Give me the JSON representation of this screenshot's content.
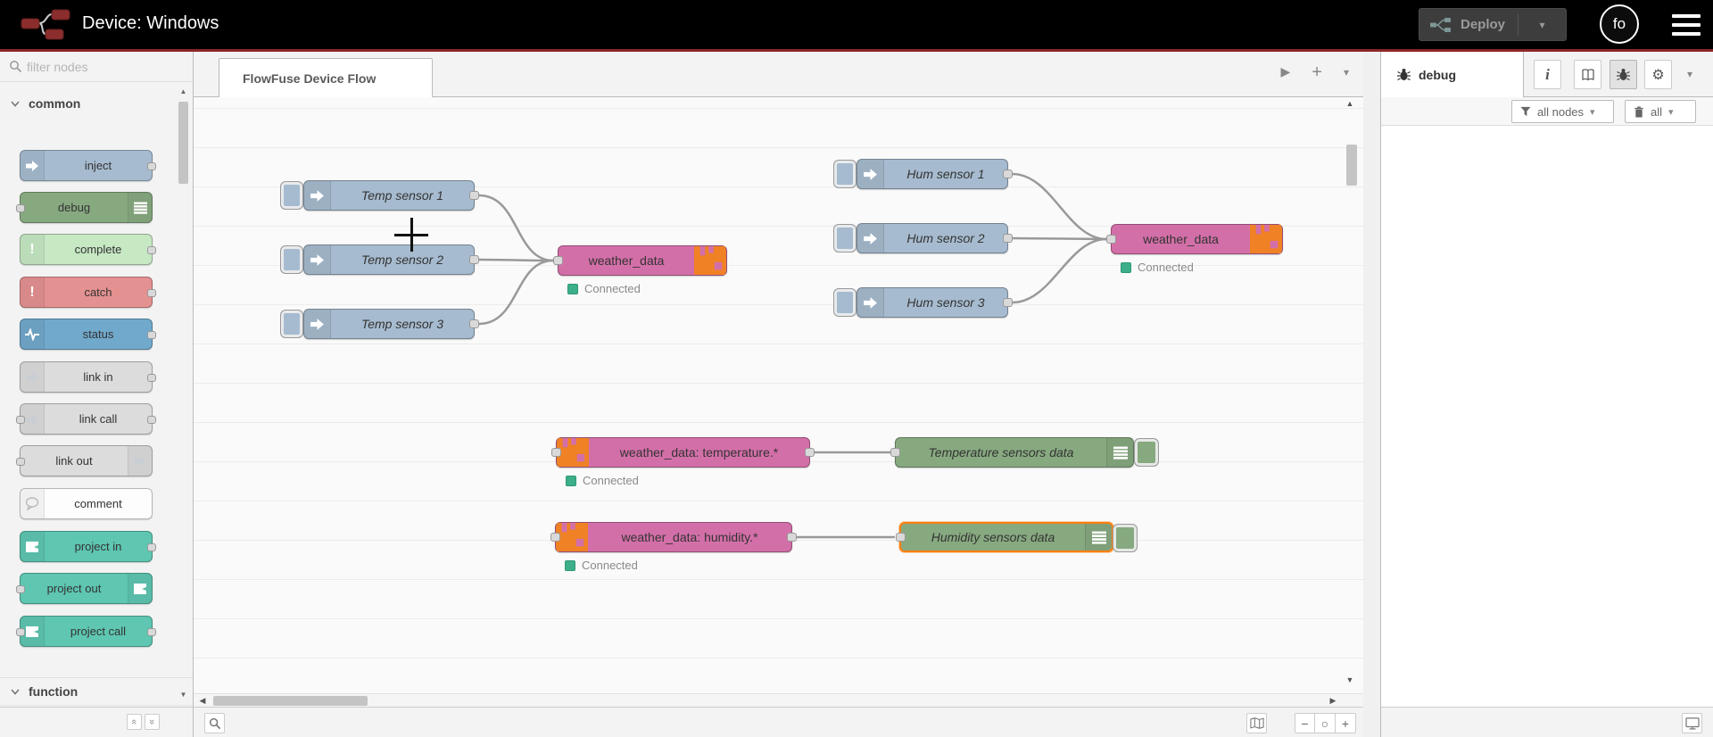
{
  "header": {
    "title": "Device: Windows",
    "deploy_label": "Deploy",
    "avatar_initials": "fo"
  },
  "palette": {
    "filter_placeholder": "filter nodes",
    "categories": [
      {
        "label": "common",
        "items": [
          {
            "label": "inject"
          },
          {
            "label": "debug"
          },
          {
            "label": "complete"
          },
          {
            "label": "catch"
          },
          {
            "label": "status"
          },
          {
            "label": "link in"
          },
          {
            "label": "link call"
          },
          {
            "label": "link out"
          },
          {
            "label": "comment"
          },
          {
            "label": "project in"
          },
          {
            "label": "project out"
          },
          {
            "label": "project call"
          }
        ]
      },
      {
        "label": "function",
        "items": []
      }
    ]
  },
  "tabbar": {
    "active_tab": "FlowFuse Device Flow"
  },
  "canvas": {
    "connected_label": "Connected",
    "nodes": {
      "temp1": {
        "label": "Temp sensor 1"
      },
      "temp2": {
        "label": "Temp sensor 2"
      },
      "temp3": {
        "label": "Temp sensor 3"
      },
      "hum1": {
        "label": "Hum sensor 1"
      },
      "hum2": {
        "label": "Hum sensor 2"
      },
      "hum3": {
        "label": "Hum sensor 3"
      },
      "wd_in_temp": {
        "label": "weather_data",
        "status": "Connected"
      },
      "wd_in_hum": {
        "label": "weather_data",
        "status": "Connected"
      },
      "wd_out_temp": {
        "label": "weather_data: temperature.*",
        "status": "Connected"
      },
      "wd_out_hum": {
        "label": "weather_data: humidity.*",
        "status": "Connected"
      },
      "dbg_temp": {
        "label": "Temperature sensors data"
      },
      "dbg_hum": {
        "label": "Humidity sensors data"
      }
    }
  },
  "sidebar": {
    "tab_label": "debug",
    "filter_nodes_label": "all nodes",
    "clear_label": "all"
  },
  "icons": {
    "play": "▶",
    "plus": "+",
    "caret_down": "▾",
    "minus": "−",
    "circle": "○",
    "up": "▲",
    "down": "▼",
    "left": "◀",
    "right": "▶",
    "collapse": "«",
    "expand": "»",
    "info": "i",
    "gear": "⚙"
  },
  "colors": {
    "accent_line": "#8c2626",
    "inject_blue": "#a6bbcf",
    "debug_green": "#87a980",
    "complete_green": "#c6e8c3",
    "catch_red": "#e49191",
    "status_blue": "#71a9cc",
    "link_gray": "#dcdcdc",
    "project_teal": "#5ec6b1",
    "link_pink": "#d36fa8",
    "link_icon_orange": "#f08225",
    "selection_orange": "#ff7f0e",
    "status_connected_green": "#3caf8a"
  }
}
